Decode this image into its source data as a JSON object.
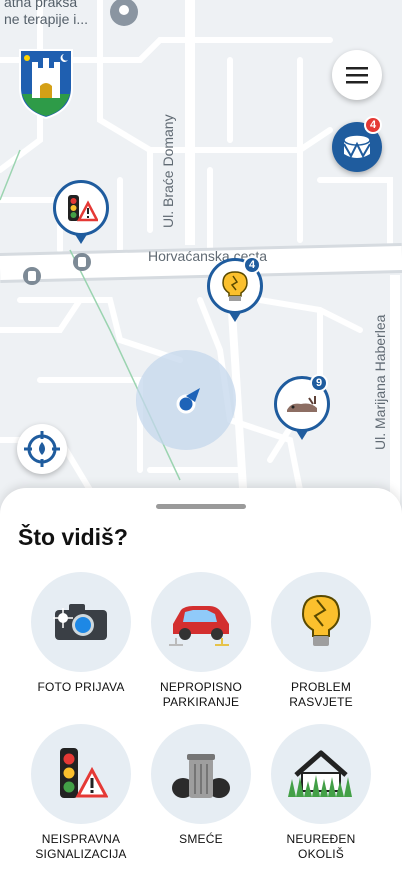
{
  "map": {
    "top_text_line1": "atna praksa",
    "top_text_line2": "ne terapije i...",
    "streets": {
      "brace_domany": "Ul. Braće Domany",
      "horvacanska": "Horvaćanska cesta",
      "marijana_haberlea": "Ul. Marijana Haberlea"
    },
    "pins": [
      {
        "icon": "traffic-light-icon",
        "count": ""
      },
      {
        "icon": "lightbulb-icon",
        "count": "4"
      },
      {
        "icon": "dead-animal-icon",
        "count": "9"
      }
    ]
  },
  "header": {
    "coat_of_arms": "zagreb-coat-of-arms",
    "drum_badge": "4"
  },
  "sheet": {
    "title": "Što vidiš?",
    "tiles": [
      {
        "label": "FOTO PRIJAVA",
        "icon": "camera-icon"
      },
      {
        "label": "NEPROPISNO\nPARKIRANJE",
        "icon": "car-icon"
      },
      {
        "label": "PROBLEM\nRASVJETE",
        "icon": "lightbulb-icon"
      },
      {
        "label": "NEISPRAVNA\nSIGNALIZACIJA",
        "icon": "traffic-light-icon"
      },
      {
        "label": "SMEĆE",
        "icon": "trash-icon"
      },
      {
        "label": "NEUREĐEN\nOKOLIŠ",
        "icon": "overgrown-house-icon"
      }
    ]
  },
  "colors": {
    "accent": "#1f5c9e",
    "badge_red": "#e53935",
    "tile_bg": "#e6edf3"
  }
}
